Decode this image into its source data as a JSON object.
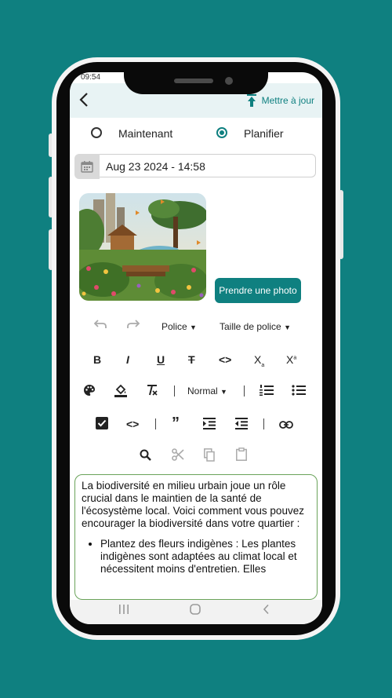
{
  "status": {
    "time": "09:54",
    "right": ""
  },
  "header": {
    "back_icon": "chevron-left-icon",
    "action_label": "Mettre à jour"
  },
  "mode": {
    "option_now": "Maintenant",
    "option_schedule": "Planifier",
    "selected": "Planifier"
  },
  "date": {
    "value": "Aug 23 2024 - 14:58"
  },
  "photo": {
    "button_label": "Prendre une photo"
  },
  "toolbar": {
    "font_label": "Police",
    "font_size_label": "Taille de police",
    "heading_label": "Normal",
    "row2": [
      "B",
      "I",
      "U",
      "S",
      "<>",
      "X",
      "X"
    ]
  },
  "editor": {
    "paragraph": "La biodiversité en milieu urbain joue un rôle crucial dans le maintien de la santé de l'écosystème local. Voici comment vous pouvez encourager la biodiversité dans votre quartier :",
    "bullet1": "Plantez des fleurs indigènes : Les plantes indigènes sont adaptées au climat local et nécessitent moins d'entretien. Elles"
  },
  "colors": {
    "accent": "#0f8080",
    "editor_border": "#6aa35a"
  }
}
